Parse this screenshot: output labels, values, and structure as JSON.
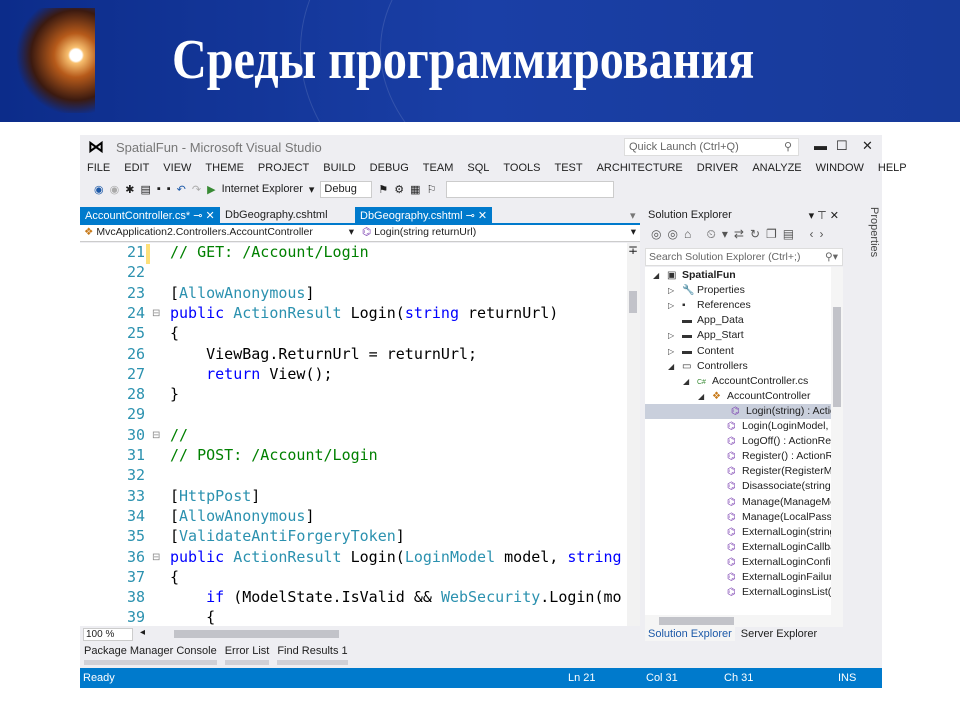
{
  "slide": {
    "title": "Среды программирования"
  },
  "window": {
    "title": "SpatialFun - Microsoft Visual Studio",
    "quick_launch": "Quick Launch (Ctrl+Q)"
  },
  "menu": [
    "FILE",
    "EDIT",
    "VIEW",
    "THEME",
    "PROJECT",
    "BUILD",
    "DEBUG",
    "TEAM",
    "SQL",
    "TOOLS",
    "TEST",
    "ARCHITECTURE",
    "DRIVER",
    "ANALYZE",
    "WINDOW",
    "HELP"
  ],
  "toolbar": {
    "run_target": "Internet Explorer",
    "config": "Debug"
  },
  "tabs": [
    {
      "label": "AccountController.cs*"
    },
    {
      "label": "DbGeography.cshtml"
    },
    {
      "label": "DbGeography.cshtml"
    }
  ],
  "nav": {
    "type": "MvcApplication2.Controllers.AccountController",
    "member": "Login(string returnUrl)"
  },
  "editor": {
    "lines": [
      {
        "n": "21",
        "tokens": [
          [
            "// GET: /Account/Login",
            "c"
          ]
        ]
      },
      {
        "n": "22",
        "tokens": []
      },
      {
        "n": "23",
        "tokens": [
          [
            "[",
            ""
          ],
          [
            "AllowAnonymous",
            "t"
          ],
          [
            "]",
            ""
          ]
        ]
      },
      {
        "n": "24",
        "fold": true,
        "tokens": [
          [
            "public ",
            "k"
          ],
          [
            "ActionResult",
            "t"
          ],
          [
            " Login(",
            ""
          ],
          [
            "string",
            "k"
          ],
          [
            " returnUrl)",
            ""
          ]
        ]
      },
      {
        "n": "25",
        "tokens": [
          [
            "{",
            ""
          ]
        ]
      },
      {
        "n": "26",
        "tokens": [
          [
            "    ViewBag.ReturnUrl = returnUrl;",
            ""
          ]
        ]
      },
      {
        "n": "27",
        "tokens": [
          [
            "    ",
            ""
          ],
          [
            "return",
            "k"
          ],
          [
            " View();",
            ""
          ]
        ]
      },
      {
        "n": "28",
        "tokens": [
          [
            "}",
            ""
          ]
        ]
      },
      {
        "n": "29",
        "tokens": []
      },
      {
        "n": "30",
        "fold": true,
        "tokens": [
          [
            "//",
            "c"
          ]
        ]
      },
      {
        "n": "31",
        "tokens": [
          [
            "// POST: /Account/Login",
            "c"
          ]
        ]
      },
      {
        "n": "32",
        "tokens": []
      },
      {
        "n": "33",
        "tokens": [
          [
            "[",
            ""
          ],
          [
            "HttpPost",
            "t"
          ],
          [
            "]",
            ""
          ]
        ]
      },
      {
        "n": "34",
        "tokens": [
          [
            "[",
            ""
          ],
          [
            "AllowAnonymous",
            "t"
          ],
          [
            "]",
            ""
          ]
        ]
      },
      {
        "n": "35",
        "tokens": [
          [
            "[",
            ""
          ],
          [
            "ValidateAntiForgeryToken",
            "t"
          ],
          [
            "]",
            ""
          ]
        ]
      },
      {
        "n": "36",
        "fold": true,
        "tokens": [
          [
            "public ",
            "k"
          ],
          [
            "ActionResult",
            "t"
          ],
          [
            " Login(",
            ""
          ],
          [
            "LoginModel",
            "t"
          ],
          [
            " model, ",
            ""
          ],
          [
            "string",
            "k"
          ]
        ]
      },
      {
        "n": "37",
        "tokens": [
          [
            "{",
            ""
          ]
        ]
      },
      {
        "n": "38",
        "tokens": [
          [
            "    ",
            ""
          ],
          [
            "if",
            "k"
          ],
          [
            " (ModelState.IsValid && ",
            ""
          ],
          [
            "WebSecurity",
            "t"
          ],
          [
            ".Login(mo",
            ""
          ]
        ]
      },
      {
        "n": "39",
        "tokens": [
          [
            "    {",
            ""
          ]
        ]
      }
    ],
    "zoom": "100 %"
  },
  "bottom_tabs": [
    "Package Manager Console",
    "Error List",
    "Find Results 1"
  ],
  "status": {
    "ready": "Ready",
    "ln": "Ln 21",
    "col": "Col 31",
    "ch": "Ch 31",
    "mode": "INS"
  },
  "solution_explorer": {
    "title": "Solution Explorer",
    "search": "Search Solution Explorer (Ctrl+;)",
    "nodes": [
      {
        "label": "SpatialFun",
        "lvl": 0,
        "tw": "◢",
        "icon": "▣",
        "bold": true
      },
      {
        "label": "Properties",
        "lvl": 1,
        "tw": "▷",
        "icon": "🔧"
      },
      {
        "label": "References",
        "lvl": 1,
        "tw": "▷",
        "icon": "▪"
      },
      {
        "label": "App_Data",
        "lvl": 1,
        "tw": "",
        "icon": "▬"
      },
      {
        "label": "App_Start",
        "lvl": 1,
        "tw": "▷",
        "icon": "▬"
      },
      {
        "label": "Content",
        "lvl": 1,
        "tw": "▷",
        "icon": "▬"
      },
      {
        "label": "Controllers",
        "lvl": 1,
        "tw": "◢",
        "icon": "▭"
      },
      {
        "label": "AccountController.cs",
        "lvl": 2,
        "tw": "◢",
        "icon": "C#"
      },
      {
        "label": "AccountController",
        "lvl": 3,
        "tw": "◢",
        "icon": "❖"
      },
      {
        "label": "Login(string) : Action",
        "lvl": 4,
        "icon": "⌬",
        "sel": true
      },
      {
        "label": "Login(LoginModel, s",
        "lvl": 4,
        "icon": "⌬"
      },
      {
        "label": "LogOff() : ActionResu",
        "lvl": 4,
        "icon": "⌬"
      },
      {
        "label": "Register() : ActionRes",
        "lvl": 4,
        "icon": "⌬"
      },
      {
        "label": "Register(RegisterMoc",
        "lvl": 4,
        "icon": "⌬"
      },
      {
        "label": "Disassociate(string, s",
        "lvl": 4,
        "icon": "⌬"
      },
      {
        "label": "Manage(ManageMes",
        "lvl": 4,
        "icon": "⌬"
      },
      {
        "label": "Manage(LocalPasswo",
        "lvl": 4,
        "icon": "⌬"
      },
      {
        "label": "ExternalLogin(string,",
        "lvl": 4,
        "icon": "⌬"
      },
      {
        "label": "ExternalLoginCallbac",
        "lvl": 4,
        "icon": "⌬"
      },
      {
        "label": "ExternalLoginConfirm",
        "lvl": 4,
        "icon": "⌬"
      },
      {
        "label": "ExternalLoginFailure(",
        "lvl": 4,
        "icon": "⌬"
      },
      {
        "label": "ExternalLoginsList(str",
        "lvl": 4,
        "icon": "⌬"
      }
    ],
    "tabs": [
      "Solution Explorer",
      "Server Explorer"
    ]
  },
  "properties_tab": "Properties"
}
